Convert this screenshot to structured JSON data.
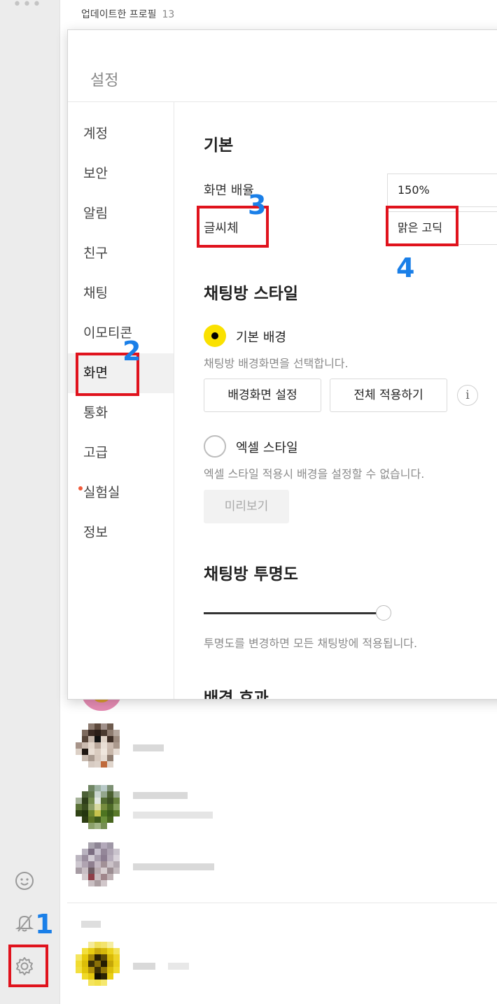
{
  "rail": {
    "dots": "•••",
    "emoji_icon": "emoticon-icon",
    "bell_icon": "notification-off-icon",
    "settings_icon": "gear-icon"
  },
  "friends": {
    "header_label": "업데이트한 프로필",
    "header_count": "13"
  },
  "settings": {
    "title": "설정",
    "menu": [
      {
        "label": "계정"
      },
      {
        "label": "보안"
      },
      {
        "label": "알림"
      },
      {
        "label": "친구"
      },
      {
        "label": "채팅"
      },
      {
        "label": "이모티콘"
      },
      {
        "label": "화면",
        "active": true
      },
      {
        "label": "통화"
      },
      {
        "label": "고급"
      },
      {
        "label": "실험실",
        "new_dot": true
      },
      {
        "label": "정보"
      }
    ],
    "basic": {
      "heading": "기본",
      "zoom_label": "화면 배율",
      "zoom_value": "150%",
      "font_label": "글씨체",
      "font_value": "맑은 고딕"
    },
    "chat_style": {
      "heading": "채팅방 스타일",
      "default_bg_label": "기본 배경",
      "default_bg_desc": "채팅방 배경화면을 선택합니다.",
      "set_bg_button": "배경화면 설정",
      "apply_all_button": "전체 적용하기",
      "info_icon": "i",
      "excel_label": "엑셀 스타일",
      "excel_desc": "엑셀 스타일 적용시 배경을 설정할 수 없습니다.",
      "preview_button": "미리보기",
      "selected": "default"
    },
    "transparency": {
      "heading": "채팅방 투명도",
      "level": 1.0,
      "desc": "투명도를 변경하면 모든 채팅방에 적용됩니다."
    },
    "bg_effect": {
      "heading": "배경 효과"
    }
  },
  "annotations": {
    "n1": "1",
    "n2": "2",
    "n3": "3",
    "n4": "4",
    "box_color": "#e0131d",
    "number_color": "#1a7fe8"
  },
  "colors": {
    "accent_yellow": "#fae100"
  }
}
